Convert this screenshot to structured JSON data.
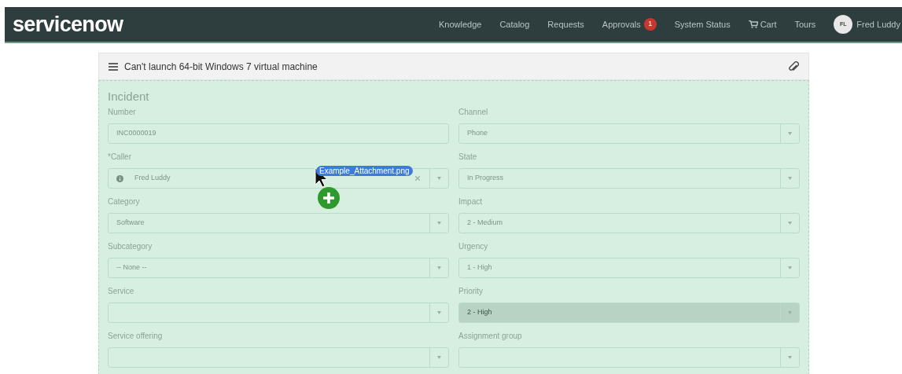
{
  "navbar": {
    "logo": "servicenow",
    "items": [
      {
        "label": "Knowledge",
        "kind": "link"
      },
      {
        "label": "Catalog",
        "kind": "link"
      },
      {
        "label": "Requests",
        "kind": "link"
      },
      {
        "label": "Approvals",
        "kind": "link",
        "badge": "1"
      },
      {
        "label": "System Status",
        "kind": "link"
      },
      {
        "label": "Cart",
        "kind": "cart"
      },
      {
        "label": "Tours",
        "kind": "link"
      }
    ],
    "user": {
      "initials": "FL",
      "name": "Fred Luddy"
    }
  },
  "record": {
    "title": "Can't launch 64-bit Windows 7 virtual machine",
    "section": "Incident",
    "fields": [
      {
        "label": "Number",
        "kind": "text",
        "value": "INC0000019",
        "disabled": false
      },
      {
        "label": "Channel",
        "kind": "select",
        "value": "Phone",
        "disabled": false
      },
      {
        "label": "Caller",
        "required_mark": "*",
        "kind": "reference",
        "value": "Fred Luddy",
        "disabled": false
      },
      {
        "label": "State",
        "kind": "select",
        "value": "In Progress",
        "disabled": false
      },
      {
        "label": "Category",
        "kind": "select",
        "value": "Software",
        "disabled": false
      },
      {
        "label": "Impact",
        "kind": "select",
        "value": "2 - Medium",
        "disabled": false
      },
      {
        "label": "Subcategory",
        "kind": "select",
        "value": "-- None --",
        "disabled": false
      },
      {
        "label": "Urgency",
        "kind": "select",
        "value": "1 - High",
        "disabled": false
      },
      {
        "label": "Service",
        "kind": "select",
        "disabled": false
      },
      {
        "label": "Priority",
        "kind": "select",
        "value": "2 - High",
        "disabled": true
      },
      {
        "label": "Service offering",
        "kind": "select",
        "disabled": false
      },
      {
        "label": "Assignment group",
        "kind": "select",
        "disabled": false
      }
    ]
  },
  "drag": {
    "file": "Example_Attachment.png"
  }
}
